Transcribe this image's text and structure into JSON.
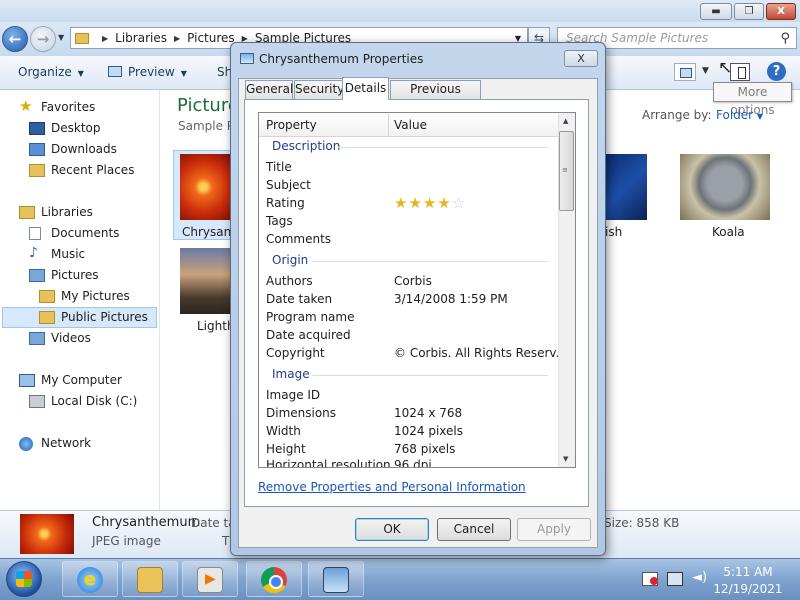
{
  "window": {
    "address": {
      "segments": [
        "Libraries",
        "Pictures",
        "Sample Pictures"
      ]
    },
    "search_placeholder": "Search Sample Pictures",
    "toolbar": {
      "organize": "Organize",
      "preview": "Preview",
      "share_partial": "Sh"
    },
    "tooltip": "More options",
    "controls": {
      "minimize": "▬",
      "maximize": "❐",
      "close": "X"
    }
  },
  "navpane": {
    "favorites": "Favorites",
    "desktop": "Desktop",
    "downloads": "Downloads",
    "recent": "Recent Places",
    "libraries": "Libraries",
    "documents": "Documents",
    "music": "Music",
    "pictures": "Pictures",
    "my_pictures": "My Pictures",
    "public_pictures": "Public Pictures",
    "videos": "Videos",
    "computer": "My Computer",
    "disk": "Local Disk (C:)",
    "network": "Network"
  },
  "content": {
    "title_partial": "Picture",
    "subtitle_partial": "Sample Pi",
    "arrange_label": "Arrange by:",
    "arrange_value": "Folder",
    "thumbs": {
      "chrysanthemum": "Chrysant",
      "lighthouse": "Lighth",
      "jellyfish": "ish",
      "koala": "Koala"
    }
  },
  "details_pane": {
    "name": "Chrysanthemum",
    "type": "JPEG image",
    "date_label": "Date ta",
    "t_partial": "T",
    "size": "Size: 858 KB"
  },
  "dialog": {
    "title": "Chrysanthemum Properties",
    "close": "X",
    "tabs": [
      "General",
      "Security",
      "Details",
      "Previous Versions"
    ],
    "active_tab": "Details",
    "columns": {
      "property": "Property",
      "value": "Value"
    },
    "groups": {
      "description": "Description",
      "origin": "Origin",
      "image": "Image"
    },
    "description": {
      "title": "Title",
      "subject": "Subject",
      "rating": "Rating",
      "tags": "Tags",
      "comments": "Comments"
    },
    "rating": {
      "filled": 4,
      "total": 5
    },
    "origin": {
      "authors_label": "Authors",
      "authors_value": "Corbis",
      "date_taken_label": "Date taken",
      "date_taken_value": "3/14/2008 1:59 PM",
      "program_name_label": "Program name",
      "date_acquired_label": "Date acquired",
      "copyright_label": "Copyright",
      "copyright_value": "© Corbis.  All Rights Reserv..."
    },
    "image": {
      "image_id_label": "Image ID",
      "dimensions_label": "Dimensions",
      "dimensions_value": "1024 x 768",
      "width_label": "Width",
      "width_value": "1024 pixels",
      "height_label": "Height",
      "height_value": "768 pixels",
      "hres_label": "Horizontal resolution",
      "hres_value": "96 dpi"
    },
    "remove_link": "Remove Properties and Personal Information",
    "buttons": {
      "ok": "OK",
      "cancel": "Cancel",
      "apply": "Apply"
    }
  },
  "taskbar": {
    "time": "5:11 AM",
    "date": "12/19/2021",
    "ie_glyph": "e"
  },
  "colors": {
    "accent": "#1f5eb5",
    "group_header": "#1e3e8a",
    "link": "#1a56b8",
    "star": "#e4b622"
  }
}
